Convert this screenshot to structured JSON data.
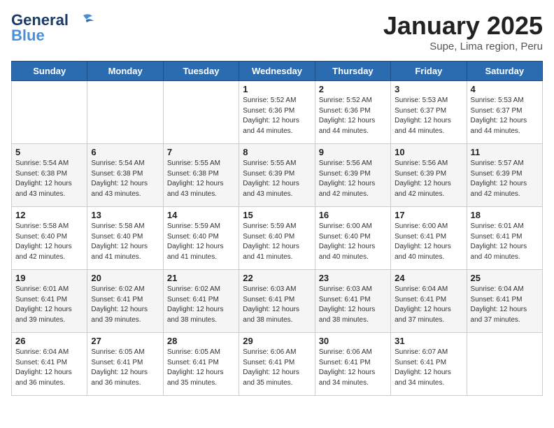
{
  "header": {
    "logo_general": "General",
    "logo_blue": "Blue",
    "title": "January 2025",
    "subtitle": "Supe, Lima region, Peru"
  },
  "days_of_week": [
    "Sunday",
    "Monday",
    "Tuesday",
    "Wednesday",
    "Thursday",
    "Friday",
    "Saturday"
  ],
  "weeks": [
    [
      {
        "day": "",
        "content": ""
      },
      {
        "day": "",
        "content": ""
      },
      {
        "day": "",
        "content": ""
      },
      {
        "day": "1",
        "content": "Sunrise: 5:52 AM\nSunset: 6:36 PM\nDaylight: 12 hours\nand 44 minutes."
      },
      {
        "day": "2",
        "content": "Sunrise: 5:52 AM\nSunset: 6:36 PM\nDaylight: 12 hours\nand 44 minutes."
      },
      {
        "day": "3",
        "content": "Sunrise: 5:53 AM\nSunset: 6:37 PM\nDaylight: 12 hours\nand 44 minutes."
      },
      {
        "day": "4",
        "content": "Sunrise: 5:53 AM\nSunset: 6:37 PM\nDaylight: 12 hours\nand 44 minutes."
      }
    ],
    [
      {
        "day": "5",
        "content": "Sunrise: 5:54 AM\nSunset: 6:38 PM\nDaylight: 12 hours\nand 43 minutes."
      },
      {
        "day": "6",
        "content": "Sunrise: 5:54 AM\nSunset: 6:38 PM\nDaylight: 12 hours\nand 43 minutes."
      },
      {
        "day": "7",
        "content": "Sunrise: 5:55 AM\nSunset: 6:38 PM\nDaylight: 12 hours\nand 43 minutes."
      },
      {
        "day": "8",
        "content": "Sunrise: 5:55 AM\nSunset: 6:39 PM\nDaylight: 12 hours\nand 43 minutes."
      },
      {
        "day": "9",
        "content": "Sunrise: 5:56 AM\nSunset: 6:39 PM\nDaylight: 12 hours\nand 42 minutes."
      },
      {
        "day": "10",
        "content": "Sunrise: 5:56 AM\nSunset: 6:39 PM\nDaylight: 12 hours\nand 42 minutes."
      },
      {
        "day": "11",
        "content": "Sunrise: 5:57 AM\nSunset: 6:39 PM\nDaylight: 12 hours\nand 42 minutes."
      }
    ],
    [
      {
        "day": "12",
        "content": "Sunrise: 5:58 AM\nSunset: 6:40 PM\nDaylight: 12 hours\nand 42 minutes."
      },
      {
        "day": "13",
        "content": "Sunrise: 5:58 AM\nSunset: 6:40 PM\nDaylight: 12 hours\nand 41 minutes."
      },
      {
        "day": "14",
        "content": "Sunrise: 5:59 AM\nSunset: 6:40 PM\nDaylight: 12 hours\nand 41 minutes."
      },
      {
        "day": "15",
        "content": "Sunrise: 5:59 AM\nSunset: 6:40 PM\nDaylight: 12 hours\nand 41 minutes."
      },
      {
        "day": "16",
        "content": "Sunrise: 6:00 AM\nSunset: 6:40 PM\nDaylight: 12 hours\nand 40 minutes."
      },
      {
        "day": "17",
        "content": "Sunrise: 6:00 AM\nSunset: 6:41 PM\nDaylight: 12 hours\nand 40 minutes."
      },
      {
        "day": "18",
        "content": "Sunrise: 6:01 AM\nSunset: 6:41 PM\nDaylight: 12 hours\nand 40 minutes."
      }
    ],
    [
      {
        "day": "19",
        "content": "Sunrise: 6:01 AM\nSunset: 6:41 PM\nDaylight: 12 hours\nand 39 minutes."
      },
      {
        "day": "20",
        "content": "Sunrise: 6:02 AM\nSunset: 6:41 PM\nDaylight: 12 hours\nand 39 minutes."
      },
      {
        "day": "21",
        "content": "Sunrise: 6:02 AM\nSunset: 6:41 PM\nDaylight: 12 hours\nand 38 minutes."
      },
      {
        "day": "22",
        "content": "Sunrise: 6:03 AM\nSunset: 6:41 PM\nDaylight: 12 hours\nand 38 minutes."
      },
      {
        "day": "23",
        "content": "Sunrise: 6:03 AM\nSunset: 6:41 PM\nDaylight: 12 hours\nand 38 minutes."
      },
      {
        "day": "24",
        "content": "Sunrise: 6:04 AM\nSunset: 6:41 PM\nDaylight: 12 hours\nand 37 minutes."
      },
      {
        "day": "25",
        "content": "Sunrise: 6:04 AM\nSunset: 6:41 PM\nDaylight: 12 hours\nand 37 minutes."
      }
    ],
    [
      {
        "day": "26",
        "content": "Sunrise: 6:04 AM\nSunset: 6:41 PM\nDaylight: 12 hours\nand 36 minutes."
      },
      {
        "day": "27",
        "content": "Sunrise: 6:05 AM\nSunset: 6:41 PM\nDaylight: 12 hours\nand 36 minutes."
      },
      {
        "day": "28",
        "content": "Sunrise: 6:05 AM\nSunset: 6:41 PM\nDaylight: 12 hours\nand 35 minutes."
      },
      {
        "day": "29",
        "content": "Sunrise: 6:06 AM\nSunset: 6:41 PM\nDaylight: 12 hours\nand 35 minutes."
      },
      {
        "day": "30",
        "content": "Sunrise: 6:06 AM\nSunset: 6:41 PM\nDaylight: 12 hours\nand 34 minutes."
      },
      {
        "day": "31",
        "content": "Sunrise: 6:07 AM\nSunset: 6:41 PM\nDaylight: 12 hours\nand 34 minutes."
      },
      {
        "day": "",
        "content": ""
      }
    ]
  ]
}
